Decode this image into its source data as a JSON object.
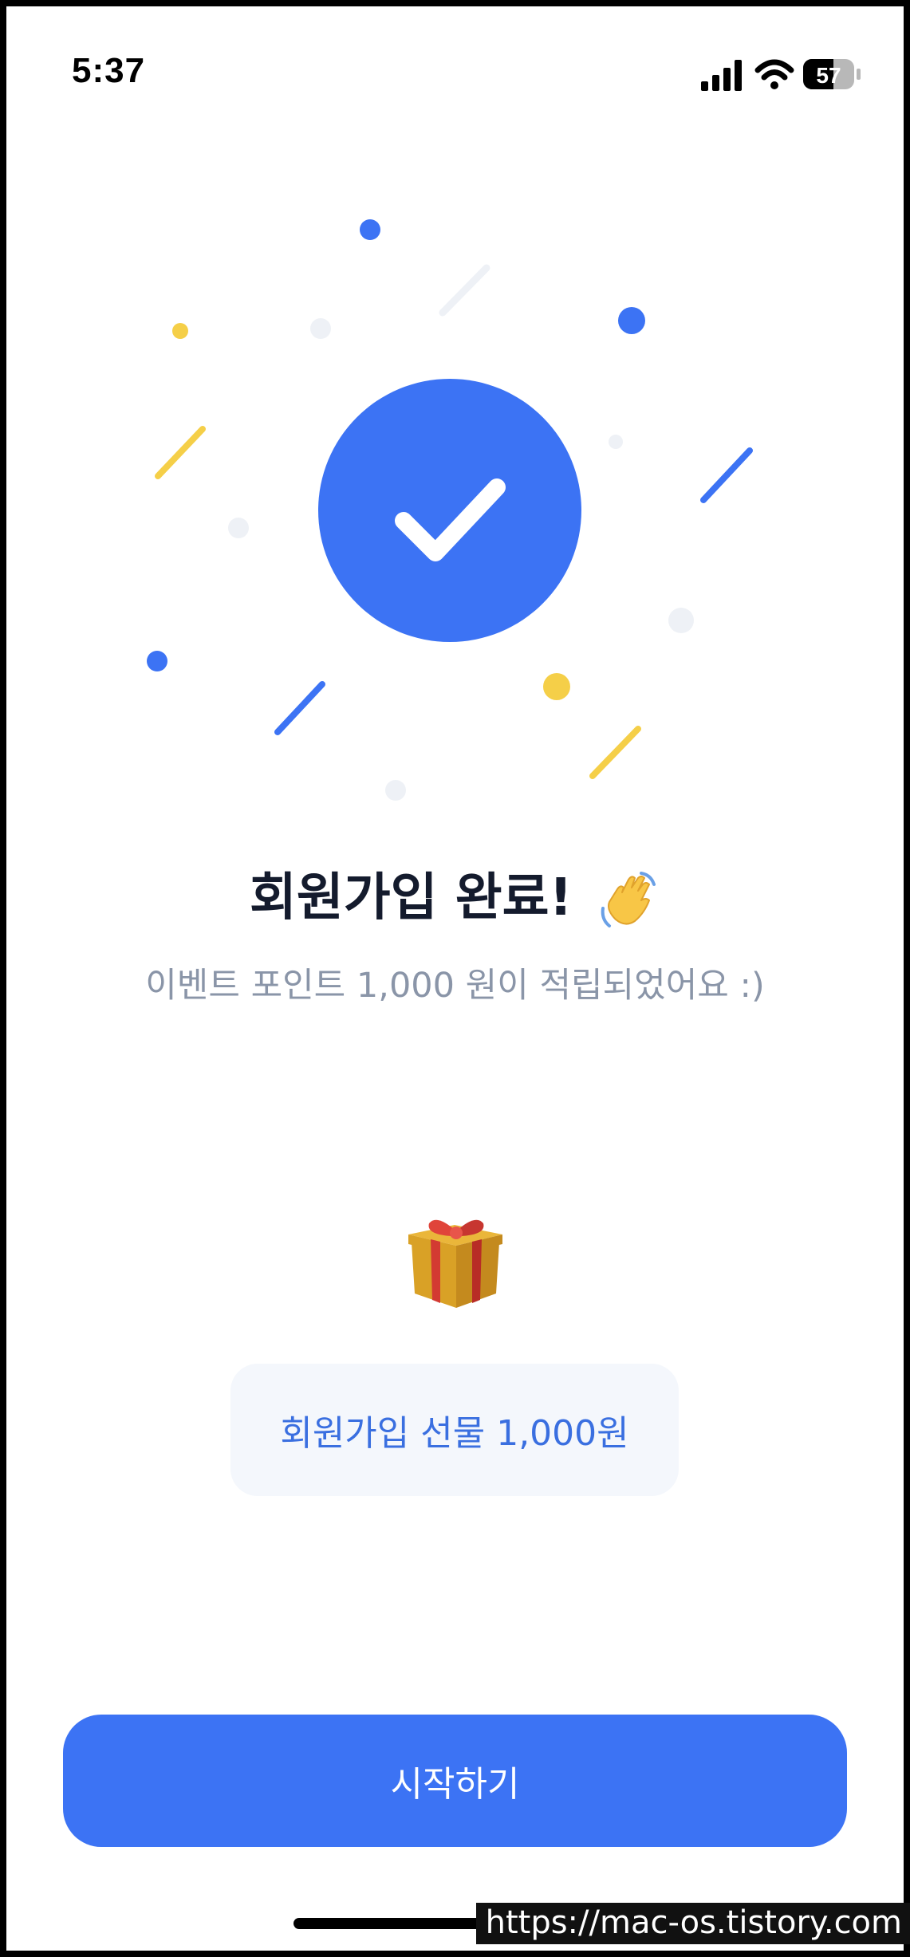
{
  "status_bar": {
    "time": "5:37",
    "battery": "57",
    "icons": [
      "signal-icon",
      "wifi-icon",
      "battery-icon"
    ]
  },
  "illustration": {
    "icon": "check-circle-icon",
    "colors": {
      "primary_blue": "#3c73f4",
      "accent_yellow": "#f5cf48",
      "light_gray": "#eef1f6"
    }
  },
  "signup": {
    "title": "회원가입 완료!",
    "title_emoji": "waving-hand-icon",
    "subtitle": "이벤트 포인트 1,000 원이 적립되었어요 :)",
    "gift_emoji": "gift-icon",
    "gift_label": "회원가입 선물 1,000원"
  },
  "actions": {
    "start_label": "시작하기"
  },
  "watermark": {
    "text": "https://mac-os.tistory.com"
  },
  "colors": {
    "title": "#141b2d",
    "subtitle": "#8a95a8",
    "pill_bg": "#f4f7fc",
    "pill_text": "#3a6fe0",
    "button_bg": "#3c73f4"
  }
}
